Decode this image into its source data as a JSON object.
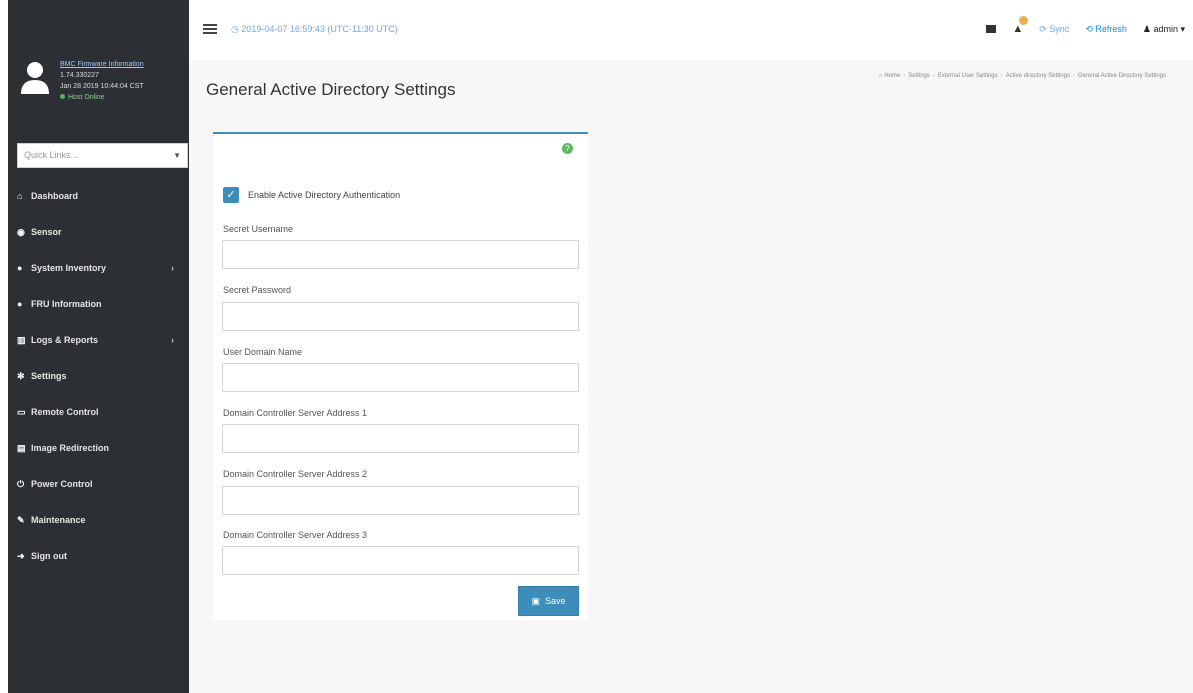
{
  "sidebar": {
    "firmware": {
      "title": "BMC Firmware Information",
      "version": "1.74.330227",
      "build_date": "Jan 28 2019 10:44:04 CST",
      "host_status": "Host Online"
    },
    "quick_links_placeholder": "Quick Links...",
    "items": [
      {
        "label": "Dashboard",
        "icon": "home-icon",
        "has_arrow": false
      },
      {
        "label": "Sensor",
        "icon": "sensor-icon",
        "has_arrow": false
      },
      {
        "label": "System Inventory",
        "icon": "info-icon",
        "has_arrow": true
      },
      {
        "label": "FRU Information",
        "icon": "info-icon",
        "has_arrow": false
      },
      {
        "label": "Logs & Reports",
        "icon": "chart-icon",
        "has_arrow": true
      },
      {
        "label": "Settings",
        "icon": "gear-icon",
        "has_arrow": false
      },
      {
        "label": "Remote Control",
        "icon": "monitor-icon",
        "has_arrow": false
      },
      {
        "label": "Image Redirection",
        "icon": "disk-icon",
        "has_arrow": false
      },
      {
        "label": "Power Control",
        "icon": "power-icon",
        "has_arrow": false
      },
      {
        "label": "Maintenance",
        "icon": "wrench-icon",
        "has_arrow": false
      },
      {
        "label": "Sign out",
        "icon": "signout-icon",
        "has_arrow": false
      }
    ]
  },
  "topbar": {
    "datetime": "2019-04-07 16:59:43 (UTC-11:30 UTC)",
    "sync_label": "Sync",
    "refresh_label": "Refresh",
    "user_label": "admin"
  },
  "breadcrumb": [
    "Home",
    "Settings",
    "External User Settings",
    "Active directory Settings",
    "General Active Directory Settings"
  ],
  "page": {
    "title": "General Active Directory Settings"
  },
  "form": {
    "enable_label": "Enable Active Directory Authentication",
    "enable_checked": true,
    "fields": [
      {
        "label": "Secret Username",
        "value": ""
      },
      {
        "label": "Secret Password",
        "value": ""
      },
      {
        "label": "User Domain Name",
        "value": ""
      },
      {
        "label": "Domain Controller Server Address 1",
        "value": ""
      },
      {
        "label": "Domain Controller Server Address 2",
        "value": ""
      },
      {
        "label": "Domain Controller Server Address 3",
        "value": ""
      }
    ],
    "save_label": "Save"
  },
  "colors": {
    "sidebar_bg": "#2c2f33",
    "accent": "#3c8dbc",
    "success": "#5cb85c",
    "badge": "#f0ad4e"
  }
}
